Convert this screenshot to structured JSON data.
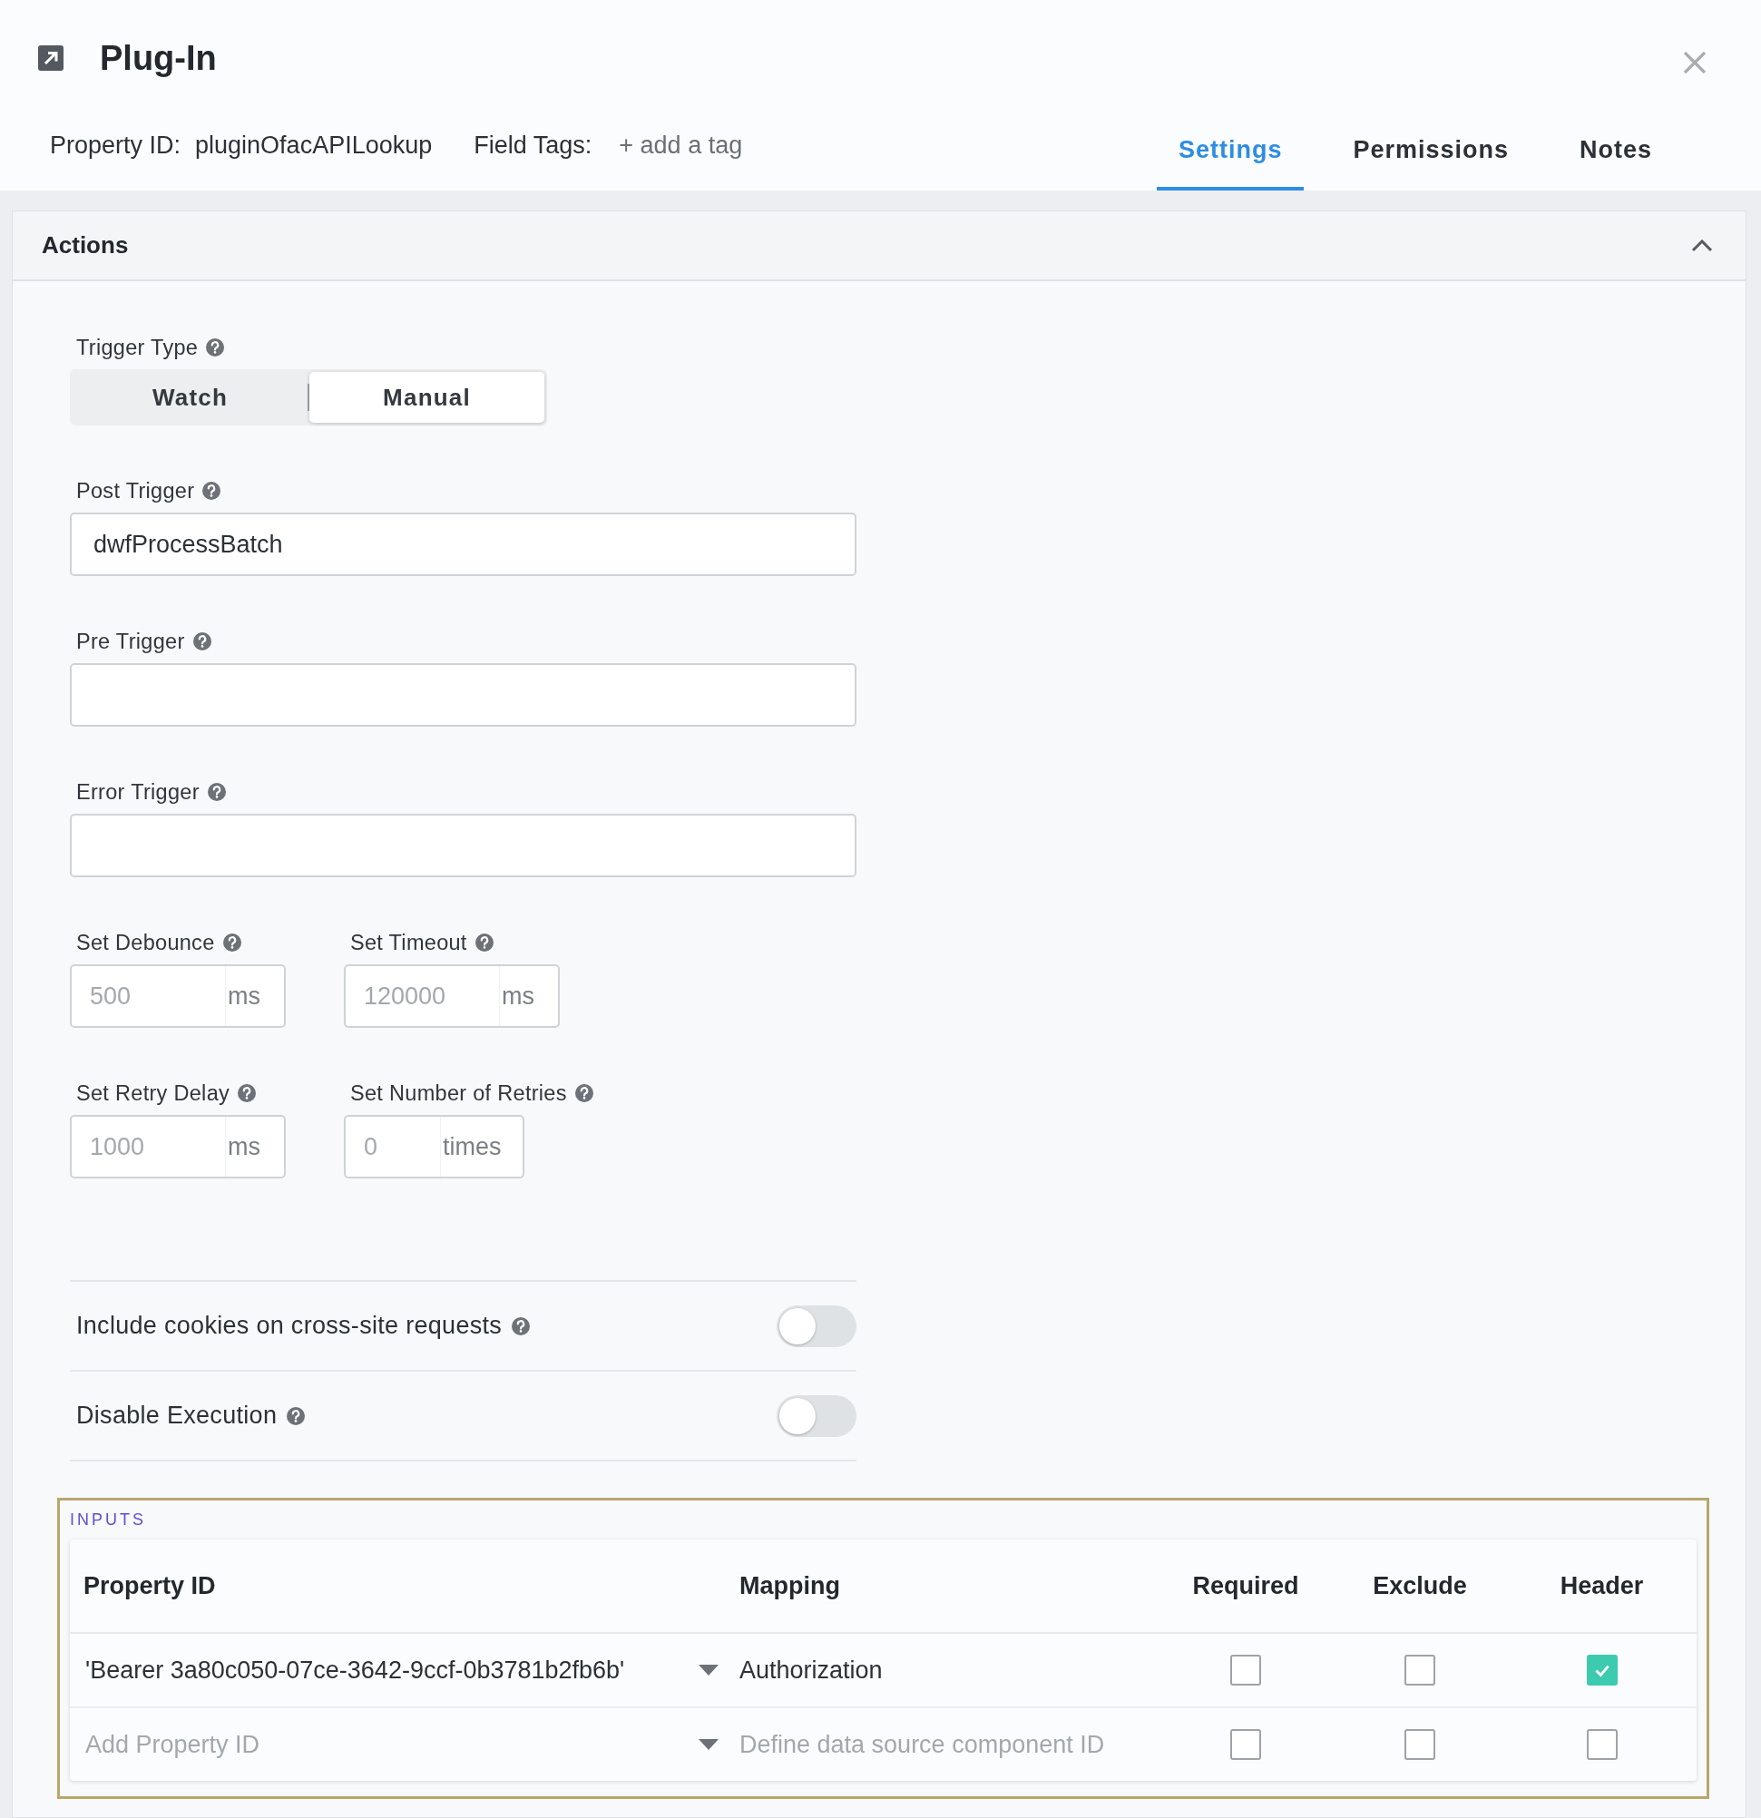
{
  "header": {
    "title": "Plug-In",
    "property_id_label": "Property ID:",
    "property_id": "pluginOfacAPILookup",
    "field_tags_label": "Field Tags:",
    "add_tag": "+ add a tag"
  },
  "tabs": [
    {
      "label": "Settings",
      "selected": true
    },
    {
      "label": "Permissions",
      "selected": false
    },
    {
      "label": "Notes",
      "selected": false
    }
  ],
  "panel": {
    "title": "Actions",
    "expanded": true
  },
  "trigger_type": {
    "label": "Trigger Type",
    "options": [
      {
        "label": "Watch",
        "selected": false
      },
      {
        "label": "Manual",
        "selected": true
      }
    ]
  },
  "text_fields": [
    {
      "label": "Post Trigger",
      "value": "dwfProcessBatch"
    },
    {
      "label": "Pre Trigger"
    },
    {
      "label": "Error Trigger"
    }
  ],
  "number_fields": [
    [
      {
        "label": "Set Debounce",
        "placeholder": "500",
        "unit": "ms"
      },
      {
        "label": "Set Timeout",
        "placeholder": "120000",
        "unit": "ms"
      }
    ],
    [
      {
        "label": "Set Retry Delay",
        "placeholder": "1000",
        "unit": "ms"
      },
      {
        "label": "Set Number of Retries",
        "placeholder": "0",
        "unit": "times"
      }
    ]
  ],
  "toggles": [
    {
      "label": "Include cookies on cross-site requests",
      "on": false
    },
    {
      "label": "Disable Execution",
      "on": false
    }
  ],
  "inputs": {
    "title": "INPUTS",
    "columns": [
      "Property ID",
      "Mapping",
      "Required",
      "Exclude",
      "Header"
    ],
    "rows": [
      {
        "property_id": {
          "value": "'Bearer 3a80c050-07ce-3642-9ccf-0b3781b2fb6b'"
        },
        "mapping": {
          "value": "Authorization"
        },
        "required": false,
        "exclude": false,
        "header": true
      },
      {
        "property_id": {
          "placeholder": "Add Property ID"
        },
        "mapping": {
          "placeholder": "Define data source component ID"
        },
        "required": false,
        "exclude": false,
        "header": false
      }
    ]
  }
}
